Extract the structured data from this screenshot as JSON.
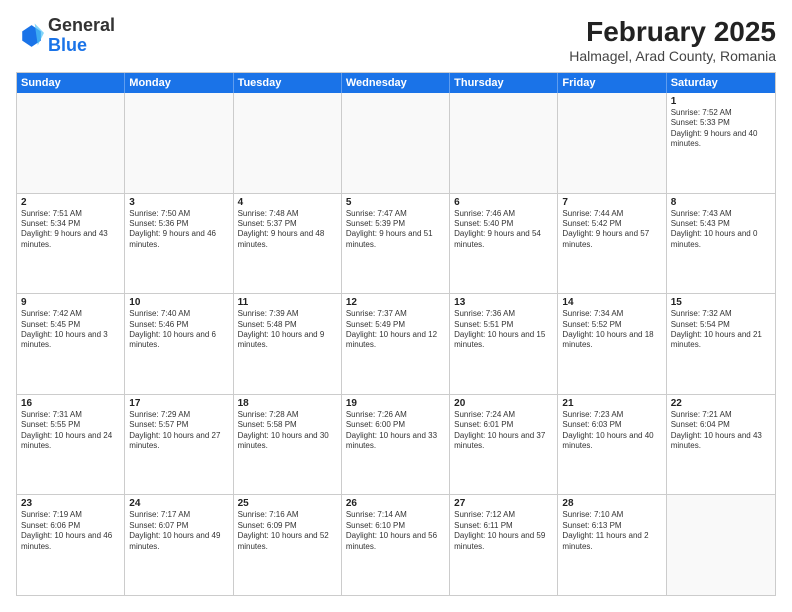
{
  "logo": {
    "general": "General",
    "blue": "Blue"
  },
  "title": "February 2025",
  "subtitle": "Halmagel, Arad County, Romania",
  "days": [
    "Sunday",
    "Monday",
    "Tuesday",
    "Wednesday",
    "Thursday",
    "Friday",
    "Saturday"
  ],
  "weeks": [
    [
      {
        "day": "",
        "info": ""
      },
      {
        "day": "",
        "info": ""
      },
      {
        "day": "",
        "info": ""
      },
      {
        "day": "",
        "info": ""
      },
      {
        "day": "",
        "info": ""
      },
      {
        "day": "",
        "info": ""
      },
      {
        "day": "1",
        "info": "Sunrise: 7:52 AM\nSunset: 5:33 PM\nDaylight: 9 hours and 40 minutes."
      }
    ],
    [
      {
        "day": "2",
        "info": "Sunrise: 7:51 AM\nSunset: 5:34 PM\nDaylight: 9 hours and 43 minutes."
      },
      {
        "day": "3",
        "info": "Sunrise: 7:50 AM\nSunset: 5:36 PM\nDaylight: 9 hours and 46 minutes."
      },
      {
        "day": "4",
        "info": "Sunrise: 7:48 AM\nSunset: 5:37 PM\nDaylight: 9 hours and 48 minutes."
      },
      {
        "day": "5",
        "info": "Sunrise: 7:47 AM\nSunset: 5:39 PM\nDaylight: 9 hours and 51 minutes."
      },
      {
        "day": "6",
        "info": "Sunrise: 7:46 AM\nSunset: 5:40 PM\nDaylight: 9 hours and 54 minutes."
      },
      {
        "day": "7",
        "info": "Sunrise: 7:44 AM\nSunset: 5:42 PM\nDaylight: 9 hours and 57 minutes."
      },
      {
        "day": "8",
        "info": "Sunrise: 7:43 AM\nSunset: 5:43 PM\nDaylight: 10 hours and 0 minutes."
      }
    ],
    [
      {
        "day": "9",
        "info": "Sunrise: 7:42 AM\nSunset: 5:45 PM\nDaylight: 10 hours and 3 minutes."
      },
      {
        "day": "10",
        "info": "Sunrise: 7:40 AM\nSunset: 5:46 PM\nDaylight: 10 hours and 6 minutes."
      },
      {
        "day": "11",
        "info": "Sunrise: 7:39 AM\nSunset: 5:48 PM\nDaylight: 10 hours and 9 minutes."
      },
      {
        "day": "12",
        "info": "Sunrise: 7:37 AM\nSunset: 5:49 PM\nDaylight: 10 hours and 12 minutes."
      },
      {
        "day": "13",
        "info": "Sunrise: 7:36 AM\nSunset: 5:51 PM\nDaylight: 10 hours and 15 minutes."
      },
      {
        "day": "14",
        "info": "Sunrise: 7:34 AM\nSunset: 5:52 PM\nDaylight: 10 hours and 18 minutes."
      },
      {
        "day": "15",
        "info": "Sunrise: 7:32 AM\nSunset: 5:54 PM\nDaylight: 10 hours and 21 minutes."
      }
    ],
    [
      {
        "day": "16",
        "info": "Sunrise: 7:31 AM\nSunset: 5:55 PM\nDaylight: 10 hours and 24 minutes."
      },
      {
        "day": "17",
        "info": "Sunrise: 7:29 AM\nSunset: 5:57 PM\nDaylight: 10 hours and 27 minutes."
      },
      {
        "day": "18",
        "info": "Sunrise: 7:28 AM\nSunset: 5:58 PM\nDaylight: 10 hours and 30 minutes."
      },
      {
        "day": "19",
        "info": "Sunrise: 7:26 AM\nSunset: 6:00 PM\nDaylight: 10 hours and 33 minutes."
      },
      {
        "day": "20",
        "info": "Sunrise: 7:24 AM\nSunset: 6:01 PM\nDaylight: 10 hours and 37 minutes."
      },
      {
        "day": "21",
        "info": "Sunrise: 7:23 AM\nSunset: 6:03 PM\nDaylight: 10 hours and 40 minutes."
      },
      {
        "day": "22",
        "info": "Sunrise: 7:21 AM\nSunset: 6:04 PM\nDaylight: 10 hours and 43 minutes."
      }
    ],
    [
      {
        "day": "23",
        "info": "Sunrise: 7:19 AM\nSunset: 6:06 PM\nDaylight: 10 hours and 46 minutes."
      },
      {
        "day": "24",
        "info": "Sunrise: 7:17 AM\nSunset: 6:07 PM\nDaylight: 10 hours and 49 minutes."
      },
      {
        "day": "25",
        "info": "Sunrise: 7:16 AM\nSunset: 6:09 PM\nDaylight: 10 hours and 52 minutes."
      },
      {
        "day": "26",
        "info": "Sunrise: 7:14 AM\nSunset: 6:10 PM\nDaylight: 10 hours and 56 minutes."
      },
      {
        "day": "27",
        "info": "Sunrise: 7:12 AM\nSunset: 6:11 PM\nDaylight: 10 hours and 59 minutes."
      },
      {
        "day": "28",
        "info": "Sunrise: 7:10 AM\nSunset: 6:13 PM\nDaylight: 11 hours and 2 minutes."
      },
      {
        "day": "",
        "info": ""
      }
    ]
  ]
}
